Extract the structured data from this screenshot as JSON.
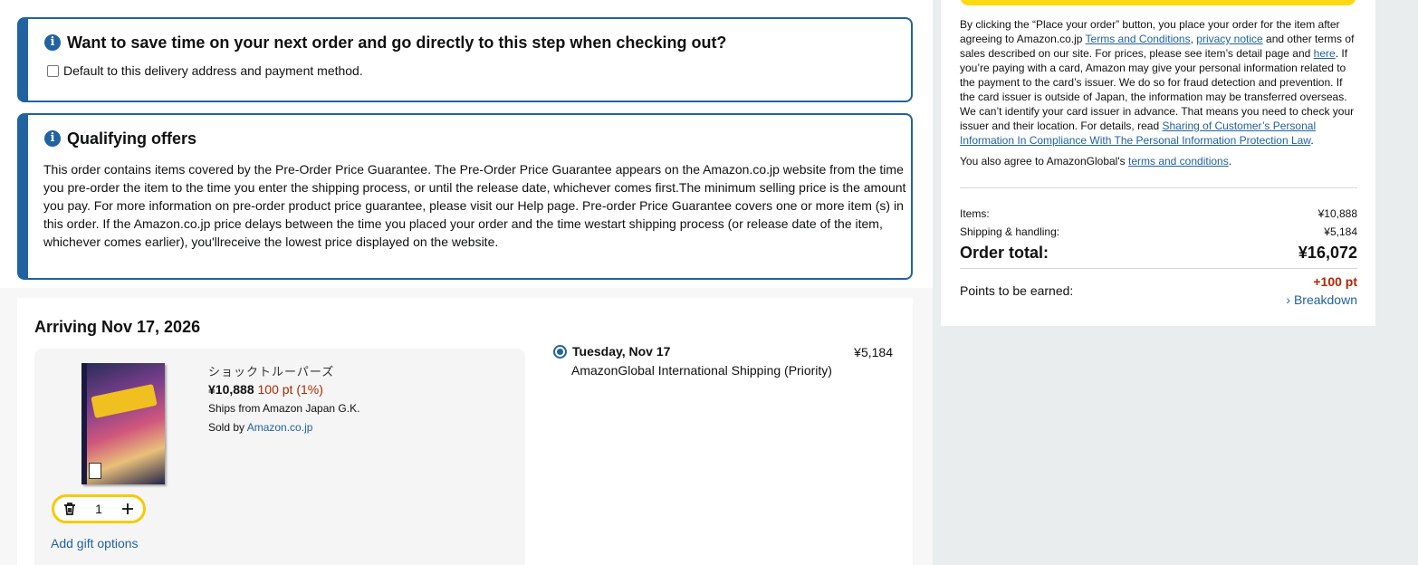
{
  "banner": {
    "title": "Want to save time on your next order and go directly to this step when checking out?",
    "checkbox_label": "Default to this delivery address and payment method."
  },
  "offers": {
    "title": "Qualifying offers",
    "body": "This order contains items covered by the Pre-Order Price Guarantee. The Pre-Order Price Guarantee appears on the Amazon.co.jp website from the time you pre-order the item to the time you enter the shipping process, or until the release date, whichever comes first.The minimum selling price is the amount you pay. For more information on pre-order product price guarantee, please visit our Help page. Pre-order Price Guarantee covers one or more item (s) in this order. If the Amazon.co.jp price delays between the time you placed your order and the time westart shipping process (or release date of the item, whichever comes earlier), you'llreceive the lowest price displayed on the website."
  },
  "shipment": {
    "arriving": "Arriving Nov 17, 2026",
    "item": {
      "title": "ショックトルーパーズ",
      "price": "¥10,888",
      "points": "100 pt (1%)",
      "ships_from": "Ships from Amazon Japan G.K.",
      "sold_by_prefix": "Sold by",
      "sold_by": "Amazon.co.jp",
      "quantity": "1",
      "gift_link": "Add gift options"
    },
    "option": {
      "date": "Tuesday, Nov 17",
      "method": "AmazonGlobal International Shipping (Priority)",
      "price": "¥5,184"
    }
  },
  "summary": {
    "legal_1": "By clicking the “Place your order” button, you place your order for the item after agreeing to Amazon.co.jp",
    "terms_link": "Terms and Conditions",
    "comma": ",",
    "privacy_link": "privacy notice",
    "legal_2": "and other terms of sales described on our site. For prices, please see item’s detail page and",
    "here_link": "here",
    "legal_3": ". If you’re paying with a card, Amazon may give your personal information related to the payment to the card’s issuer. We do so for fraud detection and prevention. If the card issuer is outside of Japan, the information may be transferred overseas. We can’t identify your card issuer in advance. That means you need to check your issuer and their location. For details, read",
    "sharing_link": "Sharing of Customer’s Personal Information In Compliance With The Personal Information Protection Law",
    "period": ".",
    "global_prefix": "You also agree to AmazonGlobal's",
    "global_link": "terms and conditions",
    "items_label": "Items:",
    "items_value": "¥10,888",
    "shipping_label": "Shipping & handling:",
    "shipping_value": "¥5,184",
    "total_label": "Order total:",
    "total_value": "¥16,072",
    "earn_label": "Points to be earned:",
    "earn_points": "+100 pt",
    "breakdown": "Breakdown"
  }
}
